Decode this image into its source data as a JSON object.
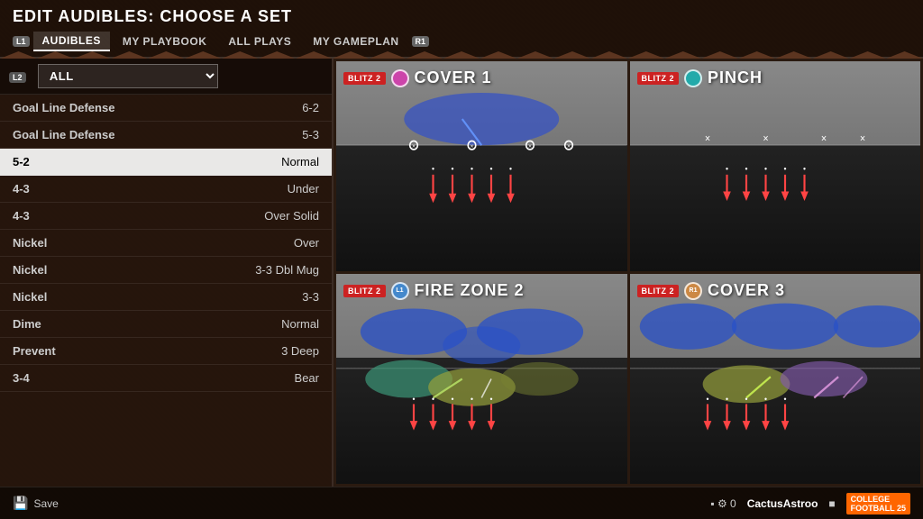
{
  "header": {
    "title": "EDIT AUDIBLES: CHOOSE A SET",
    "tabs": [
      {
        "id": "l1",
        "badge": "L1",
        "label": ""
      },
      {
        "id": "audibles",
        "label": "Audibles",
        "active": true
      },
      {
        "id": "my-playbook",
        "label": "My Playbook",
        "active": false
      },
      {
        "id": "all-plays",
        "label": "All Plays",
        "active": false
      },
      {
        "id": "my-gameplan",
        "label": "My Gameplan",
        "active": false
      },
      {
        "id": "r1",
        "badge": "R1",
        "label": ""
      }
    ],
    "filter": {
      "badge": "L2",
      "value": "ALL"
    }
  },
  "play_list": {
    "items": [
      {
        "formation": "Goal Line Defense",
        "name": "6-2"
      },
      {
        "formation": "Goal Line Defense",
        "name": "5-3"
      },
      {
        "formation": "5-2",
        "name": "Normal",
        "selected": true
      },
      {
        "formation": "4-3",
        "name": "Under"
      },
      {
        "formation": "4-3",
        "name": "Over Solid"
      },
      {
        "formation": "Nickel",
        "name": "Over"
      },
      {
        "formation": "Nickel",
        "name": "3-3 Dbl Mug"
      },
      {
        "formation": "Nickel",
        "name": "3-3"
      },
      {
        "formation": "Dime",
        "name": "Normal"
      },
      {
        "formation": "Prevent",
        "name": "3 Deep"
      },
      {
        "formation": "3-4",
        "name": "Bear"
      }
    ]
  },
  "play_cards": [
    {
      "id": "cover1",
      "badge": "BLITZ 2",
      "icon_type": "pink",
      "icon_label": "",
      "title": "COVER 1",
      "position": "top-left"
    },
    {
      "id": "pinch",
      "badge": "BLITZ 2",
      "icon_type": "teal",
      "icon_label": "",
      "title": "PINCH",
      "position": "top-right"
    },
    {
      "id": "firezone2",
      "badge": "BLITZ 2",
      "icon_type": "l1-badge",
      "icon_label": "L1",
      "title": "FIRE ZONE 2",
      "position": "bottom-left"
    },
    {
      "id": "cover3",
      "badge": "BLITZ 2",
      "icon_type": "r1-badge",
      "icon_label": "R1",
      "title": "COVER 3",
      "position": "bottom-right"
    }
  ],
  "bottom_bar": {
    "save_label": "Save",
    "icons": "▪ ⚙ 0",
    "username": "CactusAstroo",
    "user_badge": "■",
    "game_logo": "COLLEGE\nFOOTBALL 25"
  },
  "colors": {
    "accent": "#ff6600",
    "header_bg": "#1a0a05",
    "panel_bg": "#0f0804",
    "field_dark": "#111111",
    "field_light": "#888888",
    "blitz_red": "#cc2222",
    "selected_bg": "#f0f0f0"
  }
}
